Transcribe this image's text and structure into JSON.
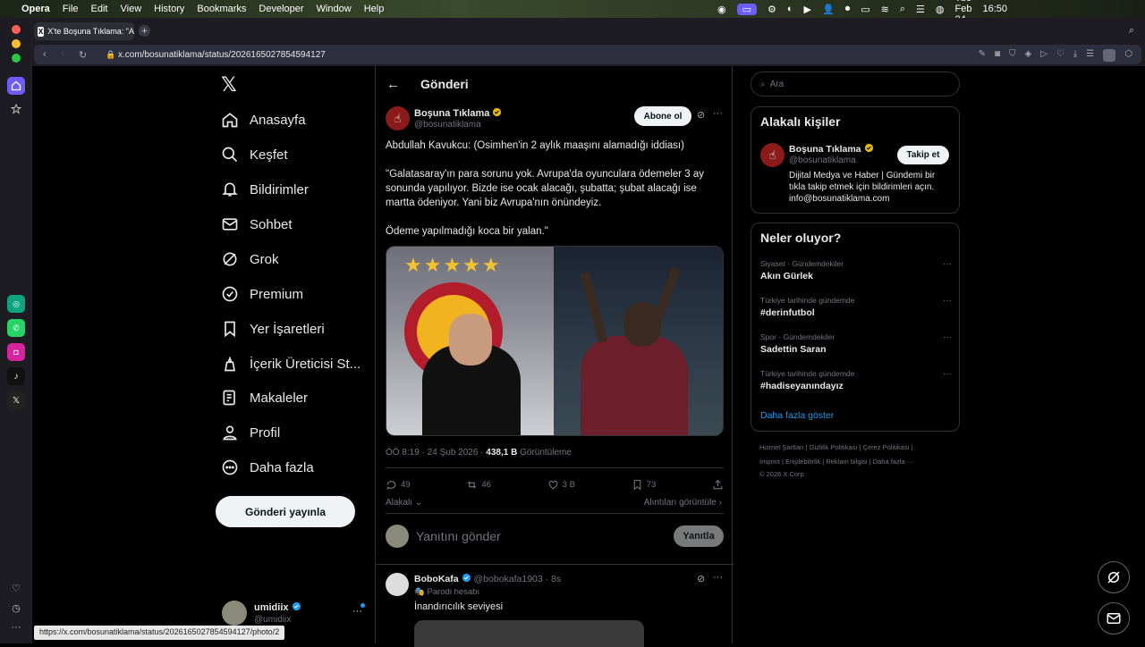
{
  "menubar": {
    "app": "Opera",
    "items": [
      "File",
      "Edit",
      "View",
      "History",
      "Bookmarks",
      "Developer",
      "Window",
      "Help"
    ],
    "date": "Tue Feb 24",
    "time": "16:50"
  },
  "tab": {
    "title": "X'te Boşuna Tıklama: \"A",
    "favicon": "X"
  },
  "address": {
    "url": "x.com/bosunatiklama/status/2026165027854594127"
  },
  "nav": {
    "items": [
      "Anasayfa",
      "Keşfet",
      "Bildirimler",
      "Sohbet",
      "Grok",
      "Premium",
      "Yer İşaretleri",
      "İçerik Üreticisi St...",
      "Makaleler",
      "Profil",
      "Daha fazla"
    ],
    "post_button": "Gönderi yayınla",
    "user": {
      "name": "umidiix",
      "handle": "@umidiix"
    }
  },
  "post": {
    "header": "Gönderi",
    "author": {
      "name": "Boşuna Tıklama",
      "handle": "@bosunatiklama"
    },
    "subscribe": "Abone ol",
    "text_lines": [
      "Abdullah Kavukcu: (Osimhen'in 2 aylık maaşını alamadığı iddiası)",
      "\"Galatasaray'ın para sorunu yok. Avrupa'da oyunculara ödemeler 3 ay",
      "sonunda yapılıyor. Bizde ise ocak alacağı, şubatta; şubat alacağı ise",
      "martta ödeniyor. Yani biz Avrupa'nın önündeyiz.",
      "Ödeme yapılmadığı koca bir yalan.\""
    ],
    "meta_time": "ÖÖ 8:19 · 24 Şub 2026 ·",
    "views_count": "438,1 B",
    "views_label": "Görüntüleme",
    "stats": {
      "replies": "49",
      "reposts": "46",
      "likes": "3 B",
      "bookmarks": "73"
    },
    "relevant": "Alakalı",
    "quotes": "Alıntıları görüntüle",
    "reply_placeholder": "Yanıtını gönder",
    "reply_button": "Yanıtla"
  },
  "reply_tweet": {
    "name": "BoboKafa",
    "handle": "@bobokafa1903 · 8s",
    "badge": "Parodi hesabı",
    "text": "İnandırıcılık seviyesi"
  },
  "sidebar": {
    "search_placeholder": "Ara",
    "related_title": "Alakalı kişiler",
    "related": {
      "name": "Boşuna Tıklama",
      "handle": "@bosunatiklama",
      "follow": "Takip et",
      "bio1": "Dijital Medya ve Haber | Gündemi bir",
      "bio2": "tıkla takip etmek için bildirimleri açın.",
      "bio3": "info@bosunatiklama.com"
    },
    "trends_title": "Neler oluyor?",
    "trends": [
      {
        "context": "Siyaset · Gündemdekiler",
        "title": "Akın Gürlek"
      },
      {
        "context": "Türkiye tarihinde gündemde",
        "title": "#derinfutbol"
      },
      {
        "context": "Spor · Gündemdekiler",
        "title": "Sadettin Saran"
      },
      {
        "context": "Türkiye tarihinde gündemde",
        "title": "#hadiseyanındayız"
      }
    ],
    "show_more": "Daha fazla göster",
    "footer1": "Hizmet Şartları  |  Gizlilik Politikası  |  Çerez Politikası  |",
    "footer2": "Imprint  |  Erişilebilirlik  |  Reklam bilgisi  |  Daha fazla ···",
    "footer3": "© 2026 X Corp."
  },
  "status_url": "https://x.com/bosunatiklama/status/2026165027854594127/photo/2",
  "colors": {
    "accent": "#1d9bf0",
    "verified": "#e2b719",
    "opera_active": "#6e5cf6"
  }
}
